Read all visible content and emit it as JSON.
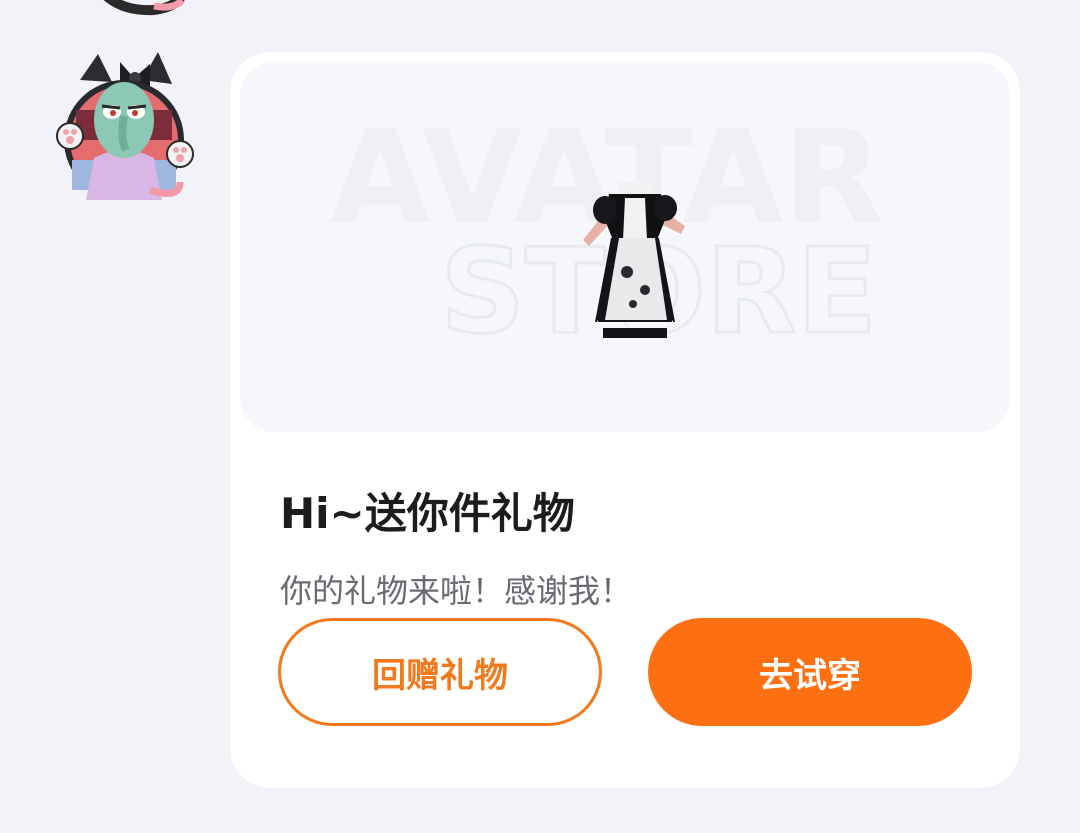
{
  "chat": {
    "previous_sender_avatar": "squidward-cat-avatar",
    "sender_avatar": "squidward-cat-avatar"
  },
  "gift_card": {
    "banner": {
      "watermark_line1": "AVATAR",
      "watermark_line2": "STORE",
      "item_image": "maid-dress-outfit"
    },
    "title": "Hi~送你件礼物",
    "message": "你的礼物来啦！感谢我！",
    "buttons": {
      "return_gift_label": "回赠礼物",
      "try_on_label": "去试穿"
    }
  },
  "colors": {
    "page_background": "#f2f3f8",
    "card_background": "#ffffff",
    "accent_orange": "#fc7012",
    "outline_orange": "#f07a1d",
    "title_text": "#1c1c1e",
    "message_text": "#6a6a72"
  }
}
